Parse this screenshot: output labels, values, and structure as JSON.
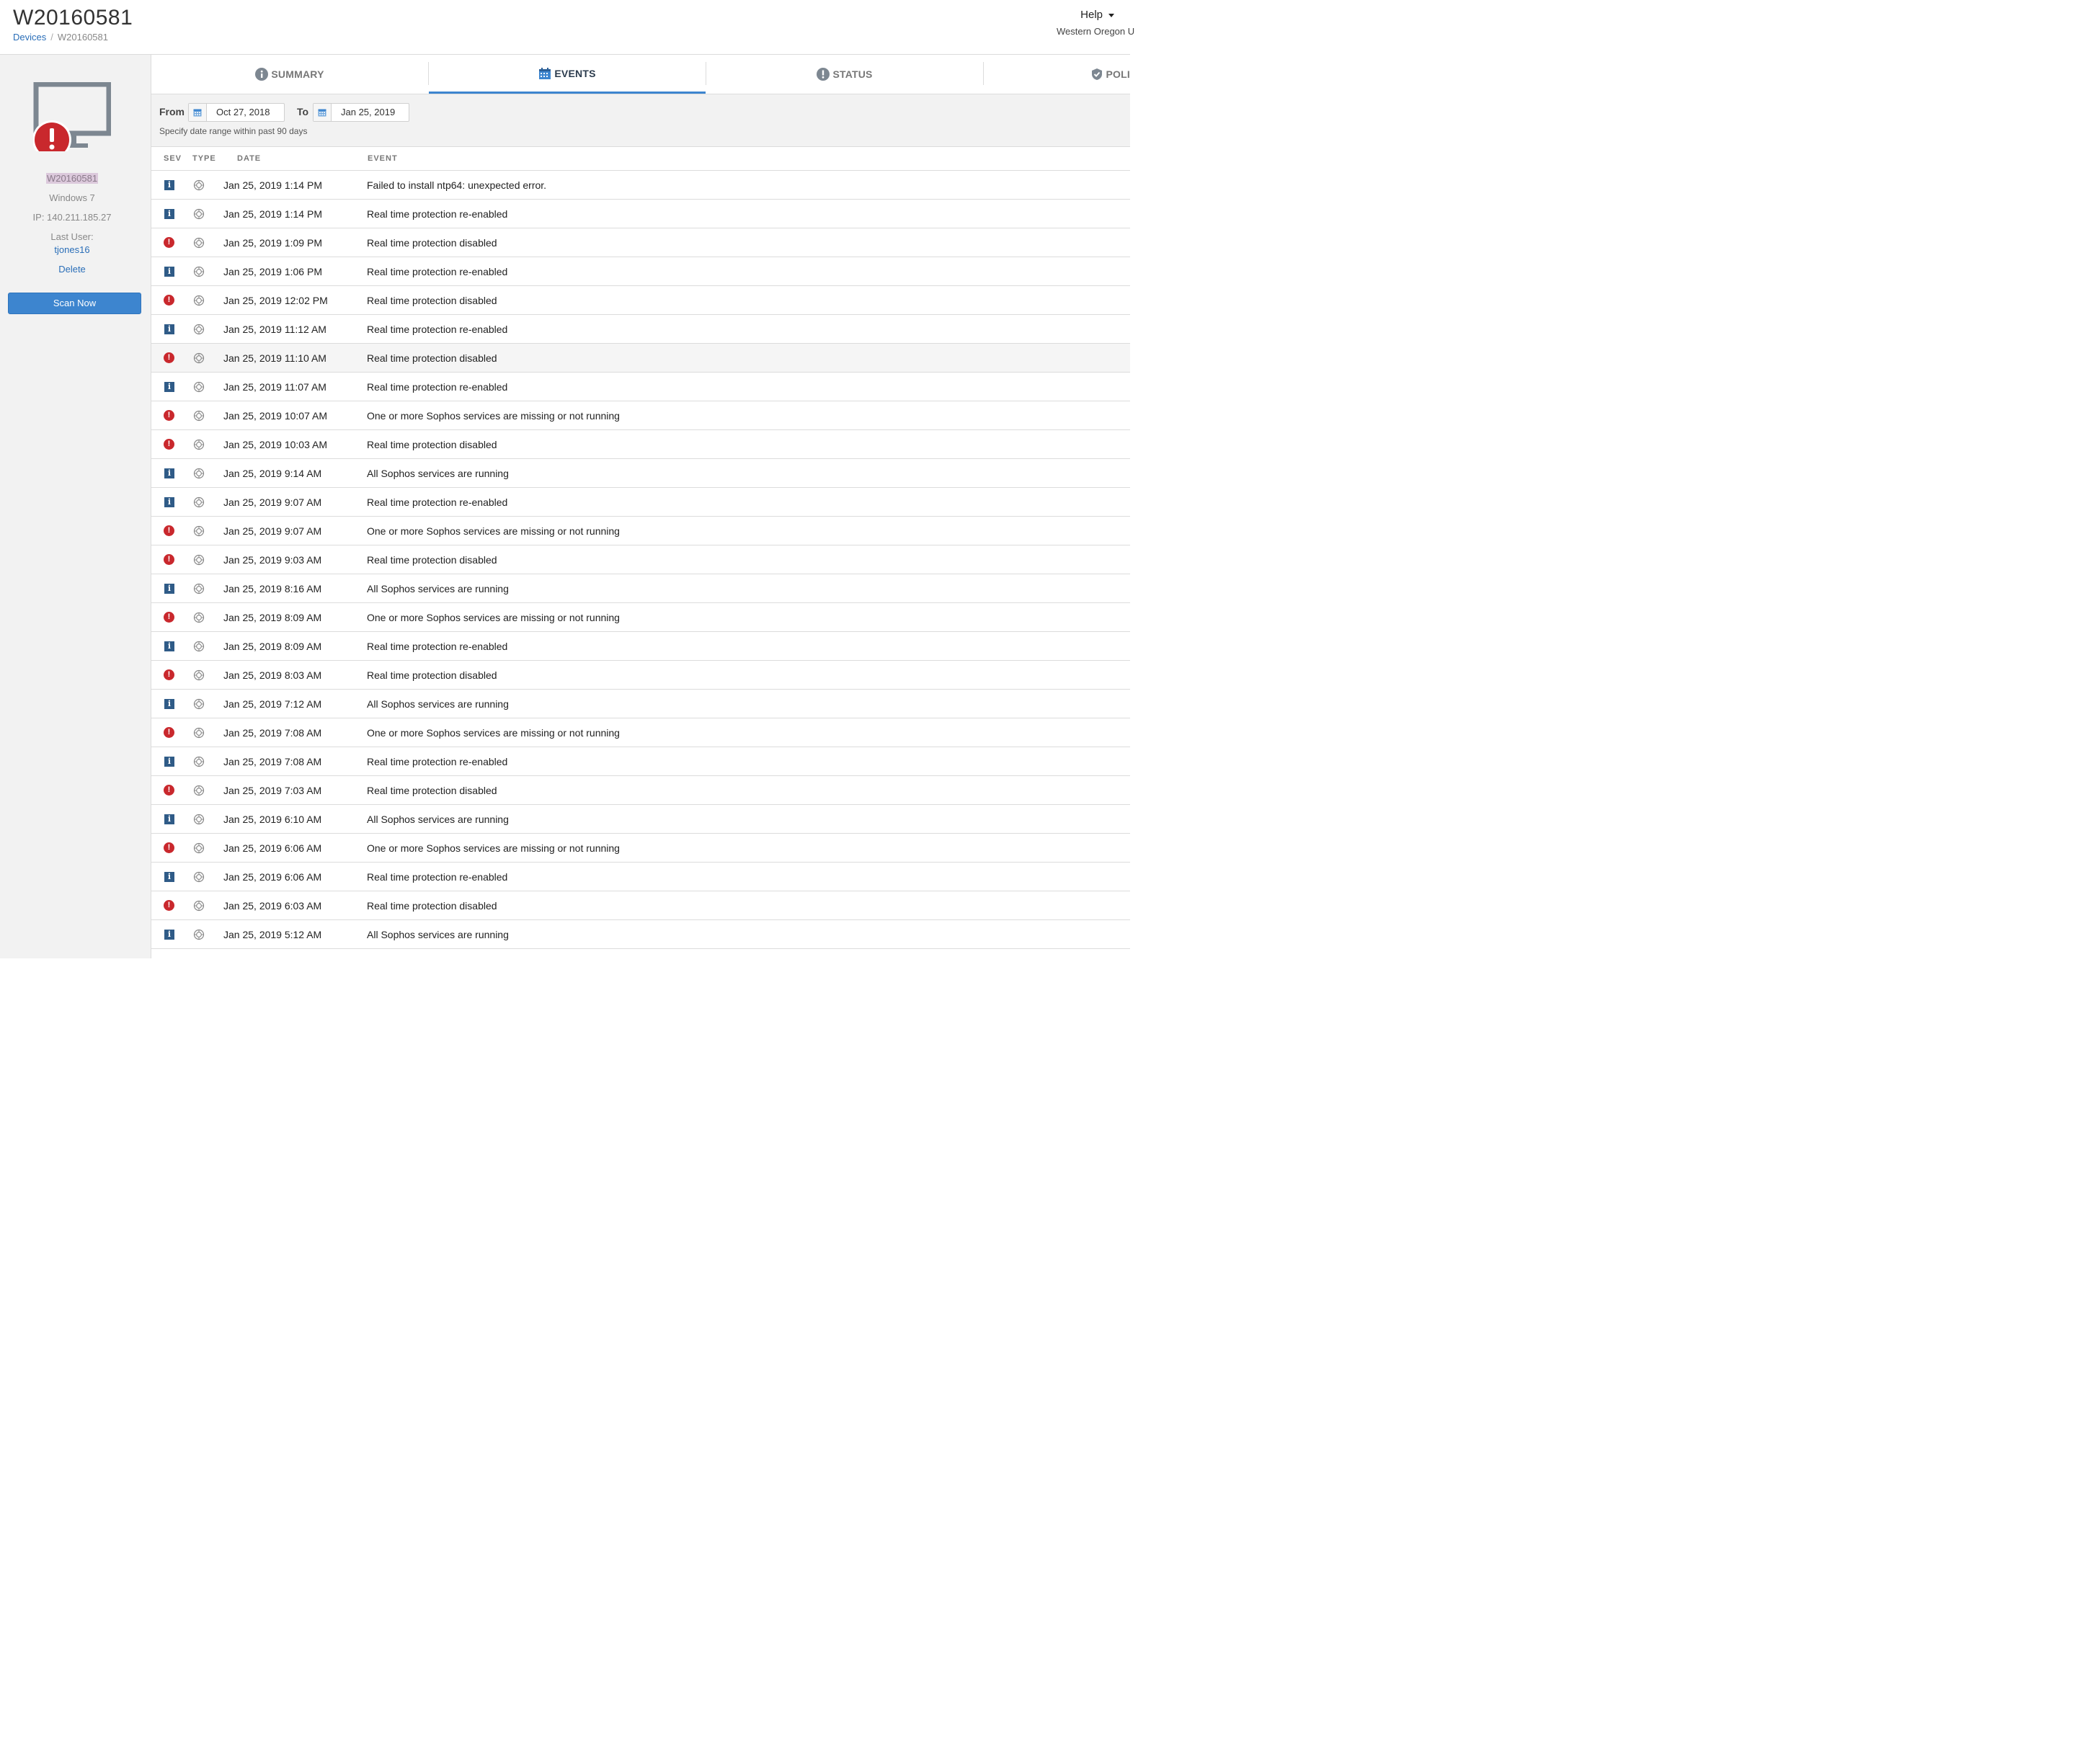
{
  "header": {
    "title": "W20160581",
    "breadcrumb": {
      "root": "Devices",
      "current": "W20160581"
    },
    "help_label": "Help",
    "org": "Western Oregon U"
  },
  "sidebar": {
    "device_name": "W20160581",
    "os": "Windows 7",
    "ip": "IP: 140.211.185.27",
    "last_user_label": "Last User:",
    "last_user": "tjones16",
    "delete_label": "Delete",
    "scan_label": "Scan Now",
    "monitor_icon": "monitor-alert-icon",
    "alert_color": "#c9282d"
  },
  "tabs": [
    {
      "label": "SUMMARY",
      "icon": "info-circle-icon",
      "active": false
    },
    {
      "label": "EVENTS",
      "icon": "calendar-icon",
      "active": true
    },
    {
      "label": "STATUS",
      "icon": "exclamation-circle-icon",
      "active": false
    },
    {
      "label": "POLI",
      "icon": "shield-check-icon",
      "active": false
    }
  ],
  "filter": {
    "from_label": "From",
    "from_value": "Oct 27, 2018",
    "to_label": "To",
    "to_value": "Jan 25, 2019",
    "hint": "Specify date range within past 90 days"
  },
  "table": {
    "columns": [
      "SEV",
      "TYPE",
      "DATE",
      "EVENT"
    ],
    "rows": [
      {
        "sev": "info",
        "date": "Jan 25, 2019 1:14 PM",
        "event": "Failed to install ntp64: unexpected error."
      },
      {
        "sev": "info",
        "date": "Jan 25, 2019 1:14 PM",
        "event": "Real time protection re-enabled"
      },
      {
        "sev": "alert",
        "date": "Jan 25, 2019 1:09 PM",
        "event": "Real time protection disabled"
      },
      {
        "sev": "info",
        "date": "Jan 25, 2019 1:06 PM",
        "event": "Real time protection re-enabled"
      },
      {
        "sev": "alert",
        "date": "Jan 25, 2019 12:02 PM",
        "event": "Real time protection disabled"
      },
      {
        "sev": "info",
        "date": "Jan 25, 2019 11:12 AM",
        "event": "Real time protection re-enabled"
      },
      {
        "sev": "alert",
        "date": "Jan 25, 2019 11:10 AM",
        "event": "Real time protection disabled",
        "highlight": true
      },
      {
        "sev": "info",
        "date": "Jan 25, 2019 11:07 AM",
        "event": "Real time protection re-enabled"
      },
      {
        "sev": "alert",
        "date": "Jan 25, 2019 10:07 AM",
        "event": "One or more Sophos services are missing or not running"
      },
      {
        "sev": "alert",
        "date": "Jan 25, 2019 10:03 AM",
        "event": "Real time protection disabled"
      },
      {
        "sev": "info",
        "date": "Jan 25, 2019 9:14 AM",
        "event": "All Sophos services are running"
      },
      {
        "sev": "info",
        "date": "Jan 25, 2019 9:07 AM",
        "event": "Real time protection re-enabled"
      },
      {
        "sev": "alert",
        "date": "Jan 25, 2019 9:07 AM",
        "event": "One or more Sophos services are missing or not running"
      },
      {
        "sev": "alert",
        "date": "Jan 25, 2019 9:03 AM",
        "event": "Real time protection disabled"
      },
      {
        "sev": "info",
        "date": "Jan 25, 2019 8:16 AM",
        "event": "All Sophos services are running"
      },
      {
        "sev": "alert",
        "date": "Jan 25, 2019 8:09 AM",
        "event": "One or more Sophos services are missing or not running"
      },
      {
        "sev": "info",
        "date": "Jan 25, 2019 8:09 AM",
        "event": "Real time protection re-enabled"
      },
      {
        "sev": "alert",
        "date": "Jan 25, 2019 8:03 AM",
        "event": "Real time protection disabled"
      },
      {
        "sev": "info",
        "date": "Jan 25, 2019 7:12 AM",
        "event": "All Sophos services are running"
      },
      {
        "sev": "alert",
        "date": "Jan 25, 2019 7:08 AM",
        "event": "One or more Sophos services are missing or not running"
      },
      {
        "sev": "info",
        "date": "Jan 25, 2019 7:08 AM",
        "event": "Real time protection re-enabled"
      },
      {
        "sev": "alert",
        "date": "Jan 25, 2019 7:03 AM",
        "event": "Real time protection disabled"
      },
      {
        "sev": "info",
        "date": "Jan 25, 2019 6:10 AM",
        "event": "All Sophos services are running"
      },
      {
        "sev": "alert",
        "date": "Jan 25, 2019 6:06 AM",
        "event": "One or more Sophos services are missing or not running"
      },
      {
        "sev": "info",
        "date": "Jan 25, 2019 6:06 AM",
        "event": "Real time protection re-enabled"
      },
      {
        "sev": "alert",
        "date": "Jan 25, 2019 6:03 AM",
        "event": "Real time protection disabled"
      },
      {
        "sev": "info",
        "date": "Jan 25, 2019 5:12 AM",
        "event": "All Sophos services are running"
      }
    ]
  }
}
